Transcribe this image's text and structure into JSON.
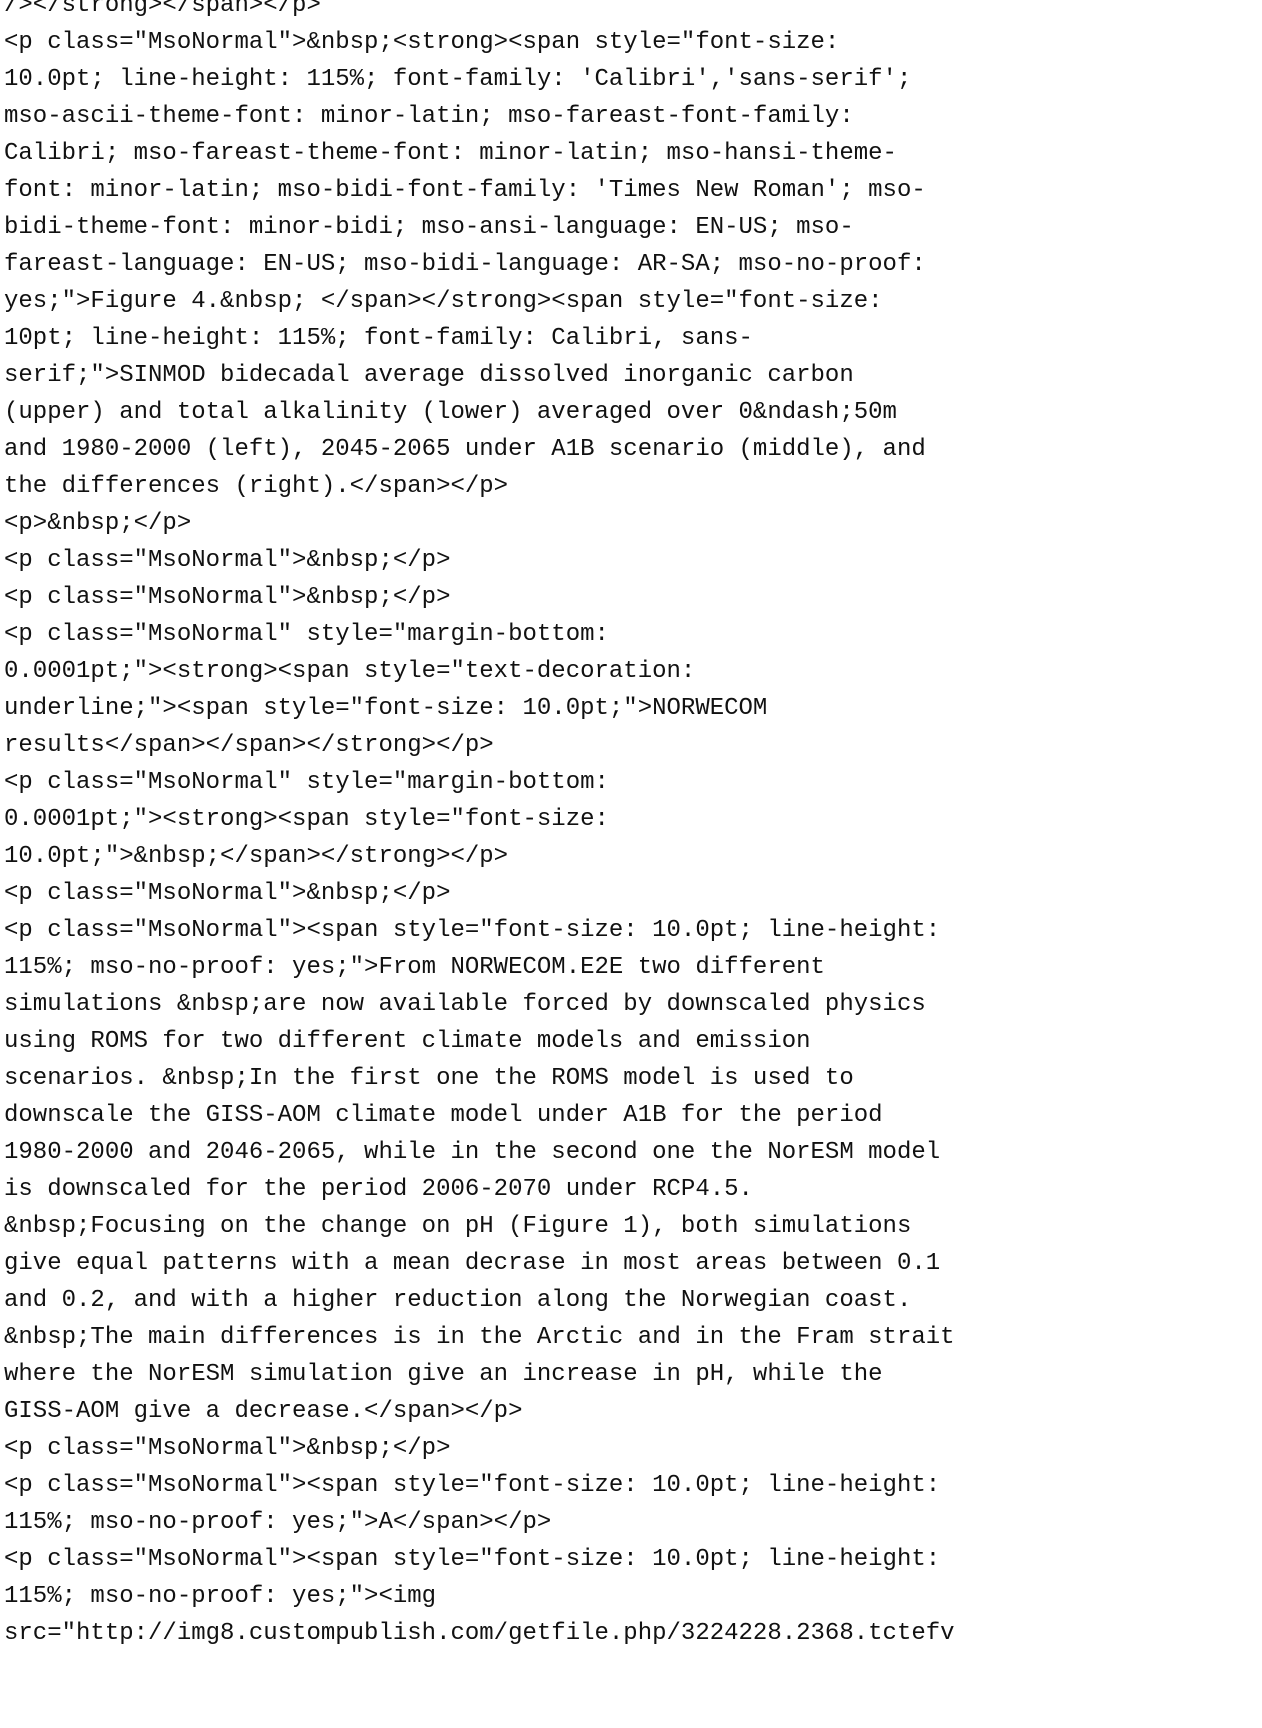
{
  "source_view": {
    "lines": [
      "/></strong></span></p>",
      "<p class=\"MsoNormal\">&nbsp;<strong><span style=\"font-size:",
      "10.0pt; line-height: 115%; font-family: 'Calibri','sans-serif';",
      "mso-ascii-theme-font: minor-latin; mso-fareast-font-family:",
      "Calibri; mso-fareast-theme-font: minor-latin; mso-hansi-theme-",
      "font: minor-latin; mso-bidi-font-family: 'Times New Roman'; mso-",
      "bidi-theme-font: minor-bidi; mso-ansi-language: EN-US; mso-",
      "fareast-language: EN-US; mso-bidi-language: AR-SA; mso-no-proof:",
      "yes;\">Figure 4.&nbsp; </span></strong><span style=\"font-size:",
      "10pt; line-height: 115%; font-family: Calibri, sans-",
      "serif;\">SINMOD bidecadal average dissolved inorganic carbon",
      "(upper) and total alkalinity (lower) averaged over 0&ndash;50m",
      "and 1980-2000 (left), 2045-2065 under A1B scenario (middle), and",
      "the differences (right).</span></p>",
      "<p>&nbsp;</p>",
      "<p class=\"MsoNormal\">&nbsp;</p>",
      "<p class=\"MsoNormal\">&nbsp;</p>",
      "<p class=\"MsoNormal\" style=\"margin-bottom:",
      "0.0001pt;\"><strong><span style=\"text-decoration:",
      "underline;\"><span style=\"font-size: 10.0pt;\">NORWECOM",
      "results</span></span></strong></p>",
      "<p class=\"MsoNormal\" style=\"margin-bottom:",
      "0.0001pt;\"><strong><span style=\"font-size:",
      "10.0pt;\">&nbsp;</span></strong></p>",
      "<p class=\"MsoNormal\">&nbsp;</p>",
      "<p class=\"MsoNormal\"><span style=\"font-size: 10.0pt; line-height:",
      "115%; mso-no-proof: yes;\">From NORWECOM.E2E two different",
      "simulations &nbsp;are now available forced by downscaled physics",
      "using ROMS for two different climate models and emission",
      "scenarios. &nbsp;In the first one the ROMS model is used to",
      "downscale the GISS-AOM climate model under A1B for the period",
      "1980-2000 and 2046-2065, while in the second one the NorESM model",
      "is downscaled for the period 2006-2070 under RCP4.5.",
      "&nbsp;Focusing on the change on pH (Figure 1), both simulations",
      "give equal patterns with a mean decrase in most areas between 0.1",
      "and 0.2, and with a higher reduction along the Norwegian coast.",
      "&nbsp;The main differences is in the Arctic and in the Fram strait",
      "where the NorESM simulation give an increase in pH, while the",
      "GISS-AOM give a decrease.</span></p>",
      "<p class=\"MsoNormal\">&nbsp;</p>",
      "<p class=\"MsoNormal\"><span style=\"font-size: 10.0pt; line-height:",
      "115%; mso-no-proof: yes;\">A</span></p>",
      "<p class=\"MsoNormal\"><span style=\"font-size: 10.0pt; line-height:",
      "115%; mso-no-proof: yes;\"><img",
      "src=\"http://img8.custompublish.com/getfile.php/3224228.2368.tctefv"
    ]
  }
}
